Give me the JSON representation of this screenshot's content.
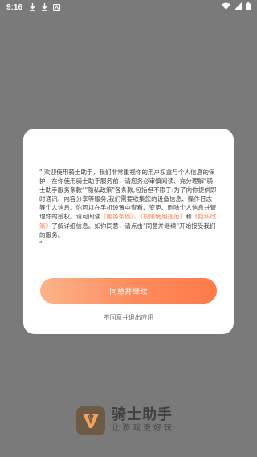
{
  "status_bar": {
    "time": "9:16",
    "left_icons": [
      "download-icon",
      "download-icon",
      "notification-icon"
    ],
    "right_icons": [
      "wifi-icon",
      "signal-icon",
      "battery-icon"
    ]
  },
  "dialog": {
    "text_prefix": "\" 欢迎使用骑士助手，我们非常重视你的用户权益与个人信息的保护，在你使用骑士助手服务前，请您务必审慎阅读、充分理解\"骑士助手服务条款\"\"隐私政策\"各条款,包括但不限于:为了向你提供即时通讯、内容分享等服务,我们需要收集您的设备信息、操作日志等个人信息。你可以在手机设置中查看、变更、删除个人信息并管理你的授权。请可阅读",
    "link_service": "《服务条例》",
    "sep1": "、",
    "link_permission": "《权限使用规范》",
    "sep2": "和",
    "link_privacy": "《隐私政策》",
    "text_suffix": "了解详细信息。如你同意，请点击\"同意并继续\"开始接受我们的服务。",
    "closing_quote": "\"",
    "agree_label": "同意并继续",
    "disagree_label": "不同意并退出应用"
  },
  "brand": {
    "name": "骑士助手",
    "slogan": "让游戏更好玩"
  },
  "colors": {
    "overlay": "#7a7a7a",
    "accent": "#ff7d45",
    "button_gradient_start": "#fbb38b",
    "button_gradient_end": "#ff7a48",
    "logo_bg": "#6d5a46"
  }
}
